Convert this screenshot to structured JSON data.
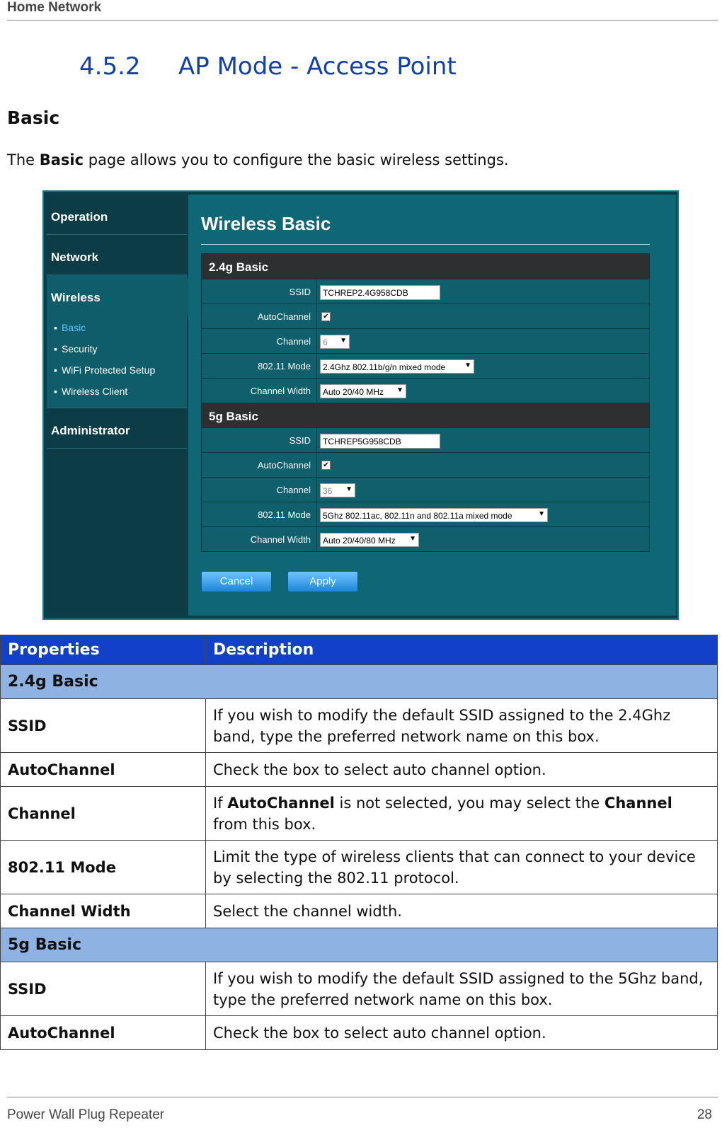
{
  "header": {
    "text": "Home Network"
  },
  "section": {
    "number": "4.5.2",
    "title": "AP Mode - Access Point"
  },
  "subsection": {
    "title": "Basic"
  },
  "intro": {
    "before": "The ",
    "bold": "Basic",
    "after": " page allows you to configure the basic wireless settings."
  },
  "screenshot": {
    "nav": {
      "operation": "Operation",
      "network": "Network",
      "wireless": "Wireless",
      "wireless_items": [
        "Basic",
        "Security",
        "WiFi Protected Setup",
        "Wireless Client"
      ],
      "administrator": "Administrator"
    },
    "title": "Wireless Basic",
    "panel_24": {
      "title": "2.4g Basic",
      "ssid_label": "SSID",
      "ssid_value": "TCHREP2.4G958CDB",
      "autochannel_label": "AutoChannel",
      "autochannel_checked": true,
      "channel_label": "Channel",
      "channel_value": "6",
      "mode_label": "802.11 Mode",
      "mode_value": "2.4Ghz 802.11b/g/n mixed mode",
      "width_label": "Channel Width",
      "width_value": "Auto 20/40 MHz"
    },
    "panel_5": {
      "title": "5g Basic",
      "ssid_label": "SSID",
      "ssid_value": "TCHREP5G958CDB",
      "autochannel_label": "AutoChannel",
      "autochannel_checked": true,
      "channel_label": "Channel",
      "channel_value": "36",
      "mode_label": "802.11 Mode",
      "mode_value": "5Ghz 802.11ac, 802.11n and 802.11a mixed mode",
      "width_label": "Channel Width",
      "width_value": "Auto 20/40/80 MHz"
    },
    "check_mark": "✔",
    "dropdown_arrow": "▼",
    "cancel_label": "Cancel",
    "apply_label": "Apply"
  },
  "table": {
    "col_properties": "Properties",
    "col_description": "Description",
    "group_24": "2.4g Basic",
    "r1_prop": "SSID",
    "r1_desc": "If you wish to modify the default SSID assigned to the 2.4Ghz band, type the preferred network name on this box.",
    "r2_prop": "AutoChannel",
    "r2_desc": "Check the box to select auto channel option.",
    "r3_prop": "Channel",
    "r3_desc_a": "If ",
    "r3_desc_b": "AutoChannel",
    "r3_desc_c": " is not selected, you may select the ",
    "r3_desc_d": "Channel",
    "r3_desc_e": " from this box.",
    "r4_prop": "802.11 Mode",
    "r4_desc": "Limit the type of wireless clients that can connect to your device by selecting the 802.11 protocol.",
    "r5_prop": "Channel Width",
    "r5_desc": "Select the channel width.",
    "group_5": "5g Basic",
    "r6_prop": "SSID",
    "r6_desc": "If you wish to modify the default SSID assigned to the 5Ghz band, type the preferred network name on this box.",
    "r7_prop": "AutoChannel",
    "r7_desc": "Check the box to select auto channel option."
  },
  "footer": {
    "left": "Power Wall Plug Repeater",
    "page": "28"
  }
}
